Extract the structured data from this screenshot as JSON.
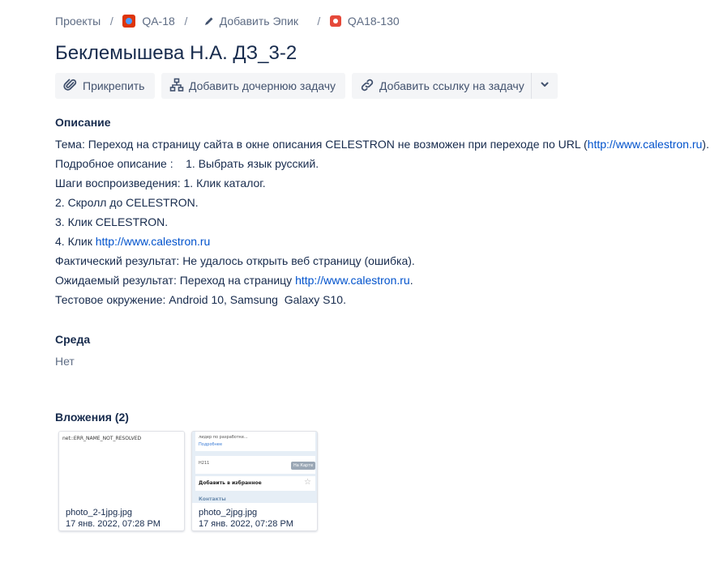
{
  "breadcrumb": {
    "projects": "Проекты",
    "project": "QA-18",
    "epic": "Добавить Эпик",
    "issue": "QA18-130"
  },
  "issue": {
    "title": "Беклемышева Н.А. ДЗ_3-2"
  },
  "toolbar": {
    "attach": "Прикрепить",
    "add_child": "Добавить дочернюю задачу",
    "add_link": "Добавить ссылку на задачу"
  },
  "description": {
    "heading": "Описание",
    "l1_pre": "Тема: Переход на страницу сайта в окне описания CELESTRON не возможен при переходе по URL (",
    "l1_link": "http://www.calestron.ru",
    "l1_post": ").",
    "l2": "Подробное описание :    1. Выбрать язык русский.",
    "l3": "Шаги воспроизведения: 1. Клик каталог.",
    "l4": "2. Скролл до CELESTRON.",
    "l5": "3. Клик CELESTRON.",
    "l6_pre": "4. Клик ",
    "l6_link": "http://www.calestron.ru",
    "l7": "Фактический результат: Не удалось открыть веб страницу (ошибка).",
    "l8_pre": "Ожидаемый результат: Переход на страницу ",
    "l8_link": "http://www.calestron.ru",
    "l8_post": ".",
    "l9": "Тестовое окружение: Android 10, Samsung  Galaxy S10."
  },
  "environment": {
    "heading": "Среда",
    "value": "Нет"
  },
  "attachments": {
    "heading": "Вложения (2)",
    "items": [
      {
        "name": "photo_2-1jpg.jpg",
        "date": "17 янв. 2022, 07:28 PM",
        "thumb_text": "net::ERR_NAME_NOT_RESOLVED"
      },
      {
        "name": "photo_2jpg.jpg",
        "date": "17 янв. 2022, 07:28 PM",
        "thumb": {
          "t1": "лидер по разработке...",
          "t2": "Подробнее",
          "t3": "Н211",
          "btn": "На Карте",
          "t4": "Добавить в избранное",
          "t5": "Контакты"
        }
      }
    ]
  },
  "colors": {
    "link": "#0052cc",
    "button_bg": "#f4f5f7",
    "text": "#172b4d",
    "muted": "#5e6c84"
  },
  "icons": [
    "paperclip-icon",
    "hierarchy-icon",
    "link-icon",
    "chevron-down-icon",
    "pencil-icon",
    "project-icon",
    "issue-type-icon"
  ]
}
